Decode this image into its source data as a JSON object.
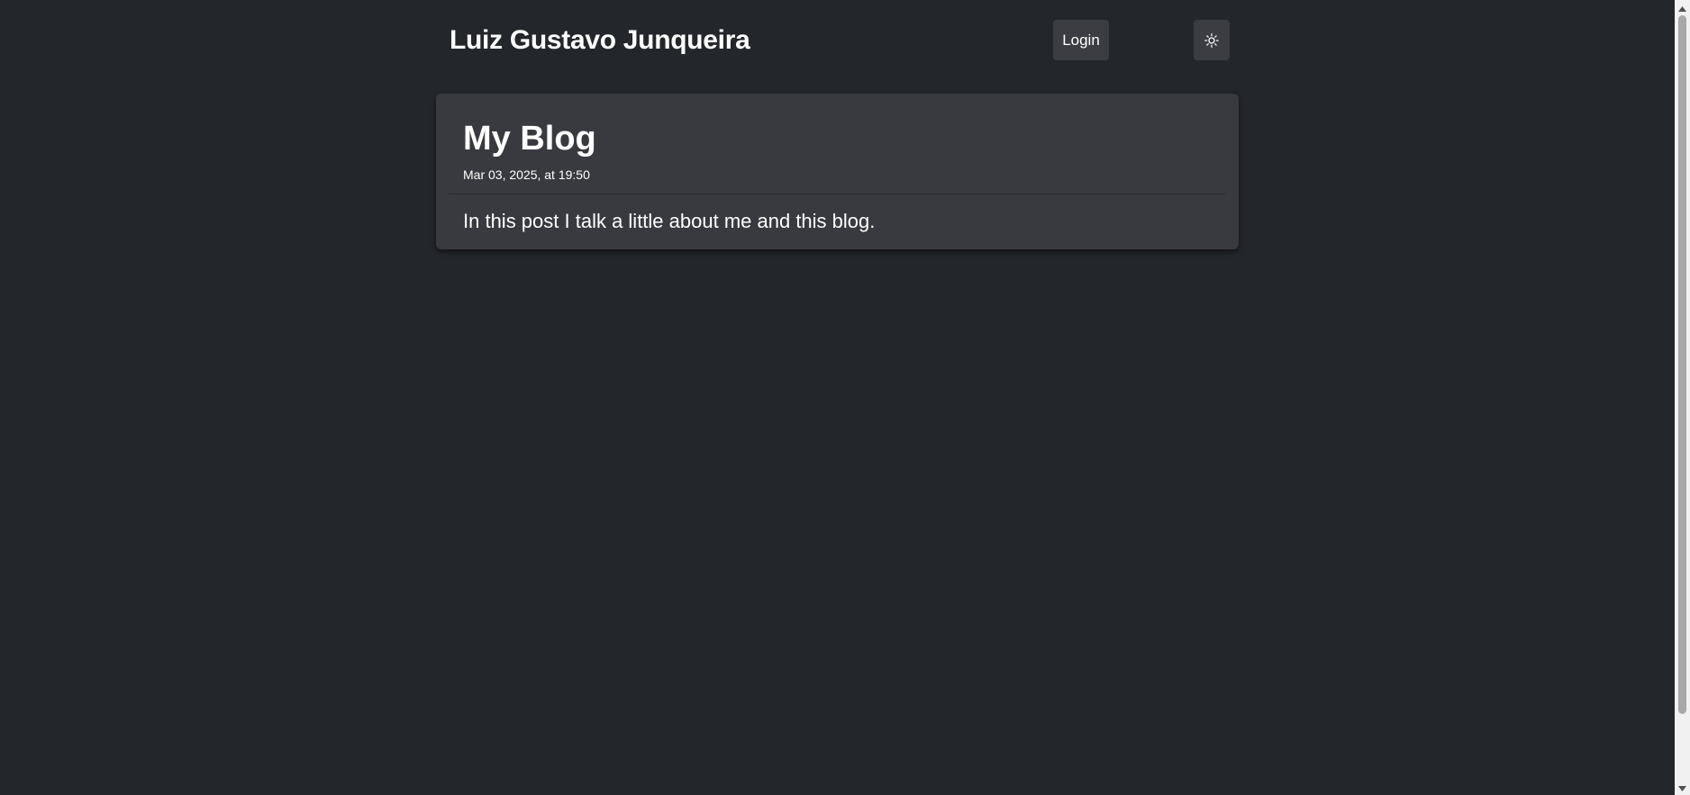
{
  "header": {
    "site_title": "Luiz Gustavo Junqueira",
    "login_label": "Login",
    "theme_toggle_icon": "sun-icon"
  },
  "post": {
    "title": "My Blog",
    "date": "Mar 03, 2025, at 19:50",
    "excerpt": "In this post I talk a little about me and this blog."
  },
  "colors": {
    "background": "#23262b",
    "card": "#393a3f",
    "button": "#3b3d42",
    "text": "#ffffff"
  },
  "icons": {
    "theme": "sun-icon",
    "scroll_up": "triangle-up-icon",
    "scroll_down": "triangle-down-icon"
  }
}
